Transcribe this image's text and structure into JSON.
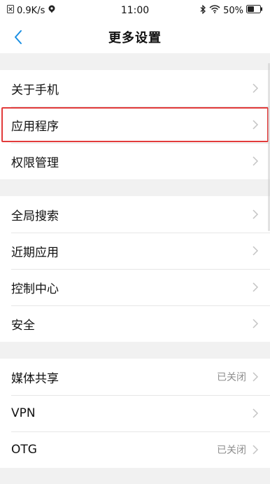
{
  "status_bar": {
    "network_speed": "0.9K/s",
    "time": "11:00",
    "battery_percent": "50%"
  },
  "header": {
    "title": "更多设置"
  },
  "groups": [
    {
      "items": [
        {
          "label": "关于手机",
          "value": ""
        },
        {
          "label": "应用程序",
          "value": ""
        },
        {
          "label": "权限管理",
          "value": ""
        }
      ]
    },
    {
      "items": [
        {
          "label": "全局搜索",
          "value": ""
        },
        {
          "label": "近期应用",
          "value": ""
        },
        {
          "label": "控制中心",
          "value": ""
        },
        {
          "label": "安全",
          "value": ""
        }
      ]
    },
    {
      "items": [
        {
          "label": "媒体共享",
          "value": "已关闭"
        },
        {
          "label": "VPN",
          "value": ""
        },
        {
          "label": "OTG",
          "value": "已关闭"
        }
      ]
    }
  ],
  "colors": {
    "accent": "#1a8fe3",
    "highlight": "#e23b3b",
    "background": "#f1f1f1"
  },
  "icons": {
    "back": "chevron-left-icon",
    "row_arrow": "chevron-right-icon"
  }
}
